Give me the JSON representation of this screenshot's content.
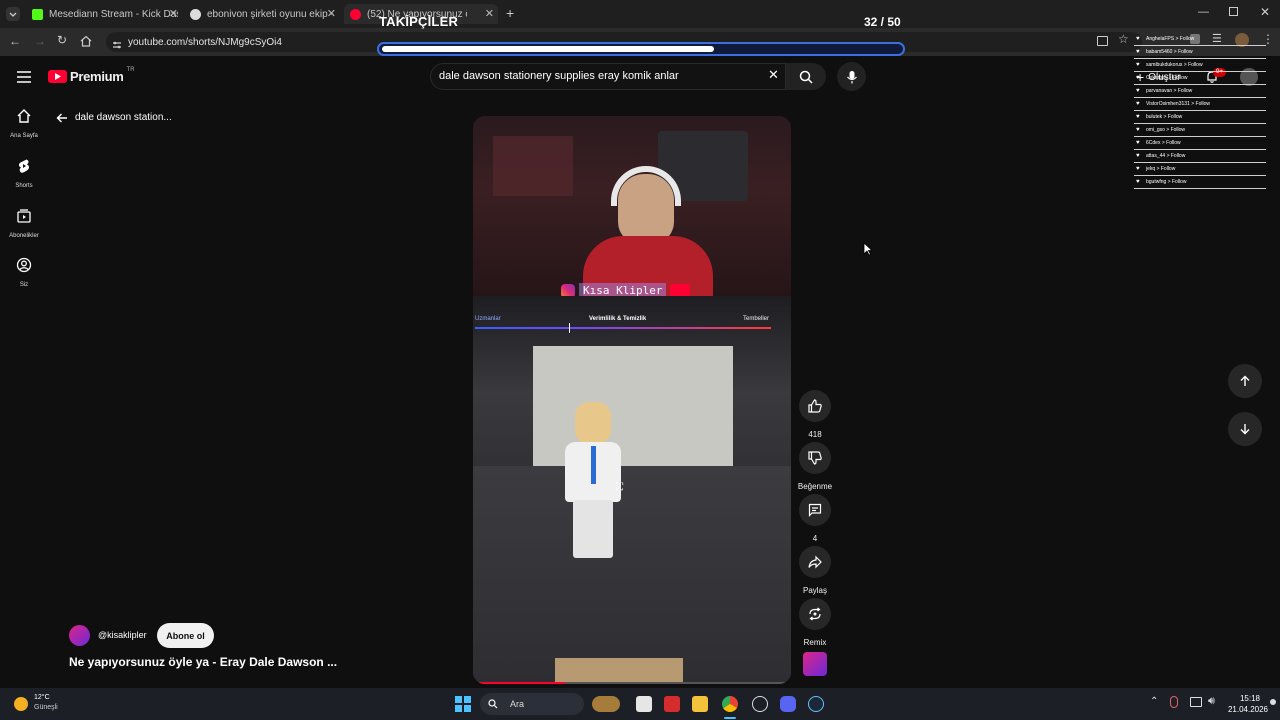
{
  "browser": {
    "tabs": [
      {
        "title": "Mesediann Stream - Kick Dashb",
        "color": "#53fc18"
      },
      {
        "title": "ebonivon şirketi oyunu ekip - G",
        "color": "#dddddd"
      },
      {
        "title": "(52) Ne yapıyorsunuz öyle y",
        "color": "#ff0033"
      }
    ],
    "url": "youtube.com/shorts/NJMg9cSyOi4"
  },
  "overlay": {
    "title": "TAKİPÇİLER",
    "count": "32 / 50",
    "progress": 0.64,
    "follows": [
      "AnghelaFPS > Follow",
      "babam5460 > Follow",
      "samibukdukorus > Follow",
      "Oskarbey > Follow",
      "parvanavan > Follow",
      "VistorOsimhen3131 > Follow",
      "bulutek > Follow",
      "omi_gso > Follow",
      "6Cdex > Follow",
      "attas_44 > Follow",
      "jekq > Follow",
      "bgutwfng > Follow"
    ]
  },
  "youtube": {
    "logo_text": "Premium",
    "logo_region": "TR",
    "search_query": "dale dawson stationery supplies eray komik anlar",
    "create_label": "Oluştur",
    "notif_count": "9+",
    "back_title": "dale dawson station...",
    "sidebar": [
      {
        "label": "Ana Sayfa",
        "icon": "home-icon"
      },
      {
        "label": "Shorts",
        "icon": "shorts-icon"
      },
      {
        "label": "Abonelikler",
        "icon": "subscriptions-icon"
      },
      {
        "label": "Siz",
        "icon": "user-icon"
      }
    ],
    "short": {
      "channel": "@kisaklipler",
      "subscribe_label": "Abone ol",
      "title": "Ne yapıyorsunuz öyle ya - Eray Dale Dawson ...",
      "watermark": "Kısa Klipler",
      "hud_left": "Uzmanlar",
      "hud_center": "Verimlilik & Temizlik",
      "hud_right": "Tembeller"
    },
    "actions": {
      "like_count": "418",
      "dislike_label": "Beğenme",
      "comment_count": "4",
      "share_label": "Paylaş",
      "remix_label": "Remix"
    }
  },
  "taskbar": {
    "weather_temp": "12°C",
    "weather_desc": "Güneşli",
    "search_label": "Ara",
    "time": "15:18",
    "date": "21.04.2026"
  },
  "colors": {
    "youtube_red": "#ff0033",
    "accent_blue": "#3b6fe0"
  }
}
